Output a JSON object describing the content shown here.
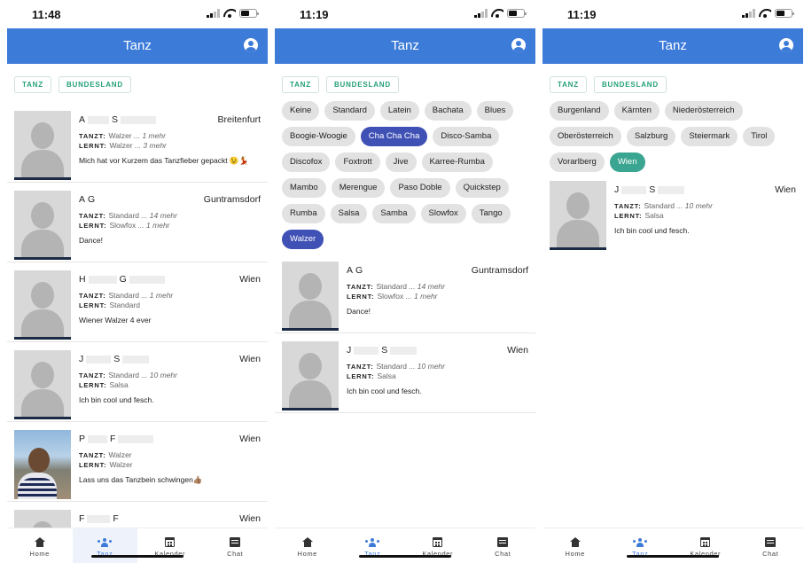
{
  "app": {
    "title": "Tanz",
    "account_icon": "account-circle-icon",
    "accent": "#3d7bd9"
  },
  "status_times": [
    "11:48",
    "11:19",
    "11:19"
  ],
  "filters": [
    "TANZ",
    "BUNDESLAND"
  ],
  "labels": {
    "tanzt": "TANZT:",
    "lernt": "LERNT:"
  },
  "nav": [
    "Home",
    "Tanz",
    "Kalender",
    "Chat"
  ],
  "dance_chips": [
    "Keine",
    "Standard",
    "Latein",
    "Bachata",
    "Blues",
    "Boogie-Woogie",
    "Cha Cha Cha",
    "Disco-Samba",
    "Discofox",
    "Foxtrott",
    "Jive",
    "Karree-Rumba",
    "Mambo",
    "Merengue",
    "Paso Doble",
    "Quickstep",
    "Rumba",
    "Salsa",
    "Samba",
    "Slowfox",
    "Tango",
    "Walzer"
  ],
  "region_chips": [
    "Burgenland",
    "Kärnten",
    "Niederösterreich",
    "Oberösterreich",
    "Salzburg",
    "Steiermark",
    "Tirol",
    "Vorarlberg",
    "Wien"
  ],
  "selected_colors": {
    "blue": "#3f51b5",
    "teal": "#3aa591"
  },
  "screen1": {
    "cards": [
      {
        "i1": "A",
        "i2": "S",
        "loc": "Breitenfurt",
        "tanzt": "Walzer",
        "tanzt_more": " ... 1 mehr",
        "lernt": "Walzer",
        "lernt_more": " ... 3 mehr",
        "msg": "Mich hat vor Kurzem das Tanzfieber gepackt 😉💃"
      },
      {
        "i1": "A",
        "i2": "G",
        "loc": "Guntramsdorf",
        "tanzt": "Standard",
        "tanzt_more": " ... 14 mehr",
        "lernt": "Slowfox",
        "lernt_more": " ... 1 mehr",
        "msg": "Dance!"
      },
      {
        "i1": "H",
        "i2": "G",
        "loc": "Wien",
        "tanzt": "Standard",
        "tanzt_more": " ... 1 mehr",
        "lernt": "Standard",
        "lernt_more": "",
        "msg": "Wiener Walzer 4 ever"
      },
      {
        "i1": "J",
        "i2": "S",
        "loc": "Wien",
        "tanzt": "Standard",
        "tanzt_more": " ... 10 mehr",
        "lernt": "Salsa",
        "lernt_more": "",
        "msg": "Ich bin cool und fesch."
      },
      {
        "i1": "P",
        "i2": "F",
        "loc": "Wien",
        "tanzt": "Walzer",
        "tanzt_more": "",
        "lernt": "Walzer",
        "lernt_more": "",
        "msg": "Lass uns das Tanzbein schwingen👍🏽"
      },
      {
        "i1": "F",
        "i2": "F",
        "loc": "Wien",
        "tanzt": "",
        "tanzt_more": "",
        "lernt": "",
        "lernt_more": "",
        "msg": ""
      }
    ]
  },
  "screen2": {
    "cards": [
      {
        "i1": "A",
        "i2": "G",
        "loc": "Guntramsdorf",
        "tanzt": "Standard",
        "tanzt_more": " ... 14 mehr",
        "lernt": "Slowfox",
        "lernt_more": " ... 1 mehr",
        "msg": "Dance!"
      },
      {
        "i1": "J",
        "i2": "S",
        "loc": "Wien",
        "tanzt": "Standard",
        "tanzt_more": " ... 10 mehr",
        "lernt": "Salsa",
        "lernt_more": "",
        "msg": "Ich bin cool und fesch."
      }
    ]
  },
  "screen3": {
    "cards": [
      {
        "i1": "J",
        "i2": "S",
        "loc": "Wien",
        "tanzt": "Standard",
        "tanzt_more": " ... 10 mehr",
        "lernt": "Salsa",
        "lernt_more": "",
        "msg": "Ich bin cool und fesch."
      }
    ]
  }
}
